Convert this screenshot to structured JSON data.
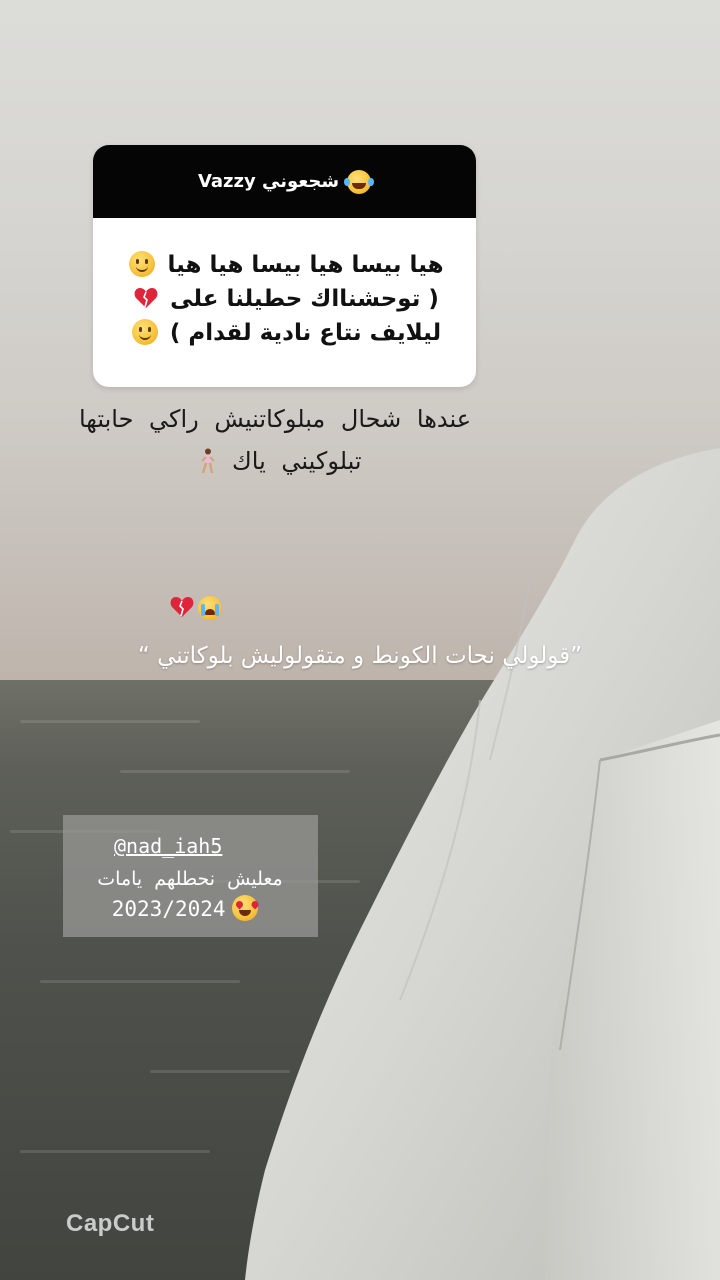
{
  "question_sticker": {
    "header_text": "شجعوني Vazzy",
    "header_icon": "face-with-tears-of-joy-emoji",
    "body_lines": [
      "هيا بيسا هيا بيسا هيا هيا",
      "( توحشنااك حطيلنا على",
      "ليلايف نتاع نادية لقدام )"
    ]
  },
  "caption": {
    "line1": "عندها  شحال  مبلوكاتنيش  راكي  حابتها",
    "line2": "تبلوكيني  ياك"
  },
  "quote": {
    "text": "”قولولي نحات الكونط و متقولوليش بلوكاتني “",
    "emojis": [
      "loudly-crying-face-emoji",
      "broken-heart-emoji"
    ]
  },
  "tag_box": {
    "handle": "@nad_iah5",
    "line1": "معليش  نحطلهم  يامات",
    "line2": "2023/2024"
  },
  "watermark": {
    "text": "CapCut"
  },
  "colors": {
    "sticker_header_bg": "#050505",
    "sticker_body_bg": "#ffffff",
    "broken_heart": "#e0243a",
    "tag_box_bg": "#969694"
  }
}
